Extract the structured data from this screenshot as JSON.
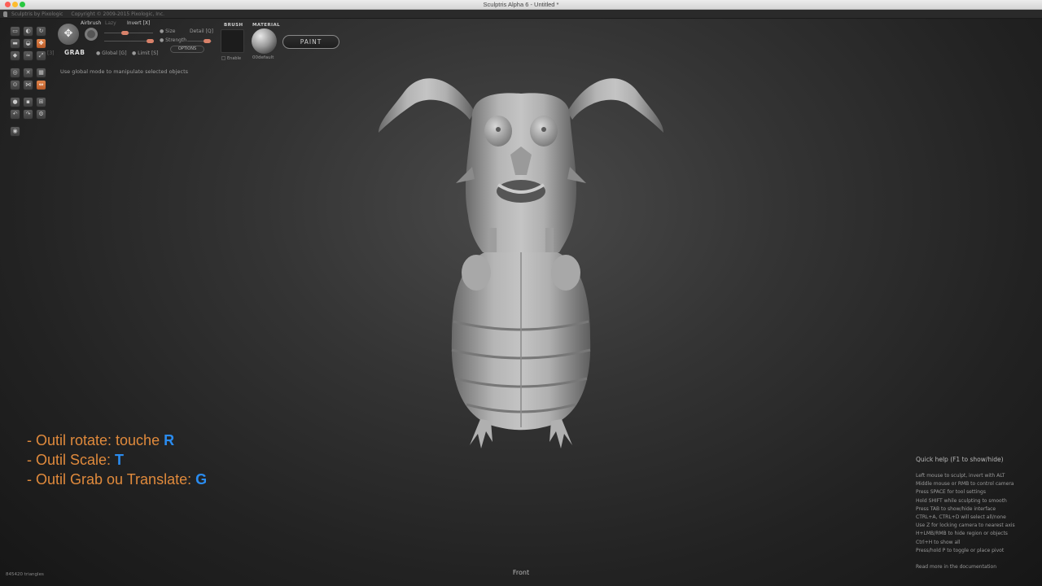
{
  "window": {
    "title": "Sculptris Alpha 6 - Untitled *"
  },
  "appstrip": {
    "app_name": "Sculptris by Pixologic",
    "copyright": "Copyright © 2009-2015 Pixologic, Inc."
  },
  "tools": [
    {
      "icon": "draw-icon",
      "glyph": "▭",
      "active": false
    },
    {
      "icon": "crease-icon",
      "glyph": "◐",
      "active": false
    },
    {
      "icon": "rotate-icon",
      "glyph": "↻",
      "active": false
    },
    {
      "icon": "flatten-icon",
      "glyph": "▬",
      "active": false
    },
    {
      "icon": "inflate-icon",
      "glyph": "◒",
      "active": false
    },
    {
      "icon": "grab-tool-icon",
      "glyph": "✥",
      "active": true
    },
    {
      "icon": "pinch-icon",
      "glyph": "◆",
      "active": false
    },
    {
      "icon": "smooth-icon",
      "glyph": "≈",
      "active": false
    },
    {
      "icon": "scale-icon",
      "glyph": "⤢",
      "active": false
    },
    {
      "icon": "reduce-icon",
      "glyph": "◎",
      "active": false
    },
    {
      "icon": "mask-icon",
      "glyph": "✕",
      "active": false
    },
    {
      "icon": "subdivide-icon",
      "glyph": "▦",
      "active": false
    },
    {
      "icon": "symmetry-icon",
      "glyph": "⊙",
      "active": false
    },
    {
      "icon": "wireframe-icon",
      "glyph": "⋈",
      "active": false
    },
    {
      "icon": "move-object-icon",
      "glyph": "⇔",
      "active": true
    },
    {
      "icon": "add-sphere-icon",
      "glyph": "●",
      "active": false
    },
    {
      "icon": "add-plane-icon",
      "glyph": "▪",
      "active": false
    },
    {
      "icon": "import-icon",
      "glyph": "⊞",
      "active": false
    },
    {
      "icon": "undo-icon",
      "glyph": "↶",
      "active": false
    },
    {
      "icon": "redo-icon",
      "glyph": "↷",
      "active": false
    },
    {
      "icon": "settings-icon",
      "glyph": "⚙",
      "active": false
    },
    {
      "icon": "eye-icon",
      "glyph": "◉",
      "active": false
    }
  ],
  "toolbar": {
    "tool_name": "GRAB",
    "airbrush": "Airbrush",
    "lazy": "Lazy",
    "invert": "Invert [X]",
    "size": "Size",
    "detail": "Detail [Q]",
    "strength": "Strength",
    "global": "Global [G]",
    "limit": "Limit [S]",
    "options": "OPTIONS",
    "shortcut_hint": "[3]",
    "brush_label": "BRUSH",
    "enable_label": "Enable",
    "material_label": "MATERIAL",
    "material_name": "00default",
    "paint_button": "PAINT"
  },
  "hint": "Use global mode to manipulate selected objects",
  "overlay": [
    {
      "text": "- Outil rotate: touche ",
      "key": "R"
    },
    {
      "text": "- Outil Scale: ",
      "key": "T"
    },
    {
      "text": "- Outil Grab ou Translate: ",
      "key": "G"
    }
  ],
  "quickhelp": {
    "title": "Quick help (F1 to show/hide)",
    "items": [
      "Left mouse to sculpt, invert with ALT",
      "Middle mouse or RMB to control camera",
      "Press SPACE for tool settings",
      "Hold SHIFT while sculpting to smooth",
      "Press TAB to show/hide interface",
      "CTRL+A, CTRL+D will select all/none",
      "Use Z for locking camera to nearest axis",
      "H+LMB/RMB to hide region or objects",
      "Ctrl+H to show all",
      "Press/hold P to toggle or place pivot"
    ],
    "more": "Read more in the documentation"
  },
  "view_label": "Front",
  "triangles": "845420 triangles",
  "colors": {
    "accent_orange": "#e08a3c",
    "key_blue": "#2a8cf0",
    "active_tool": "#d06a36"
  }
}
